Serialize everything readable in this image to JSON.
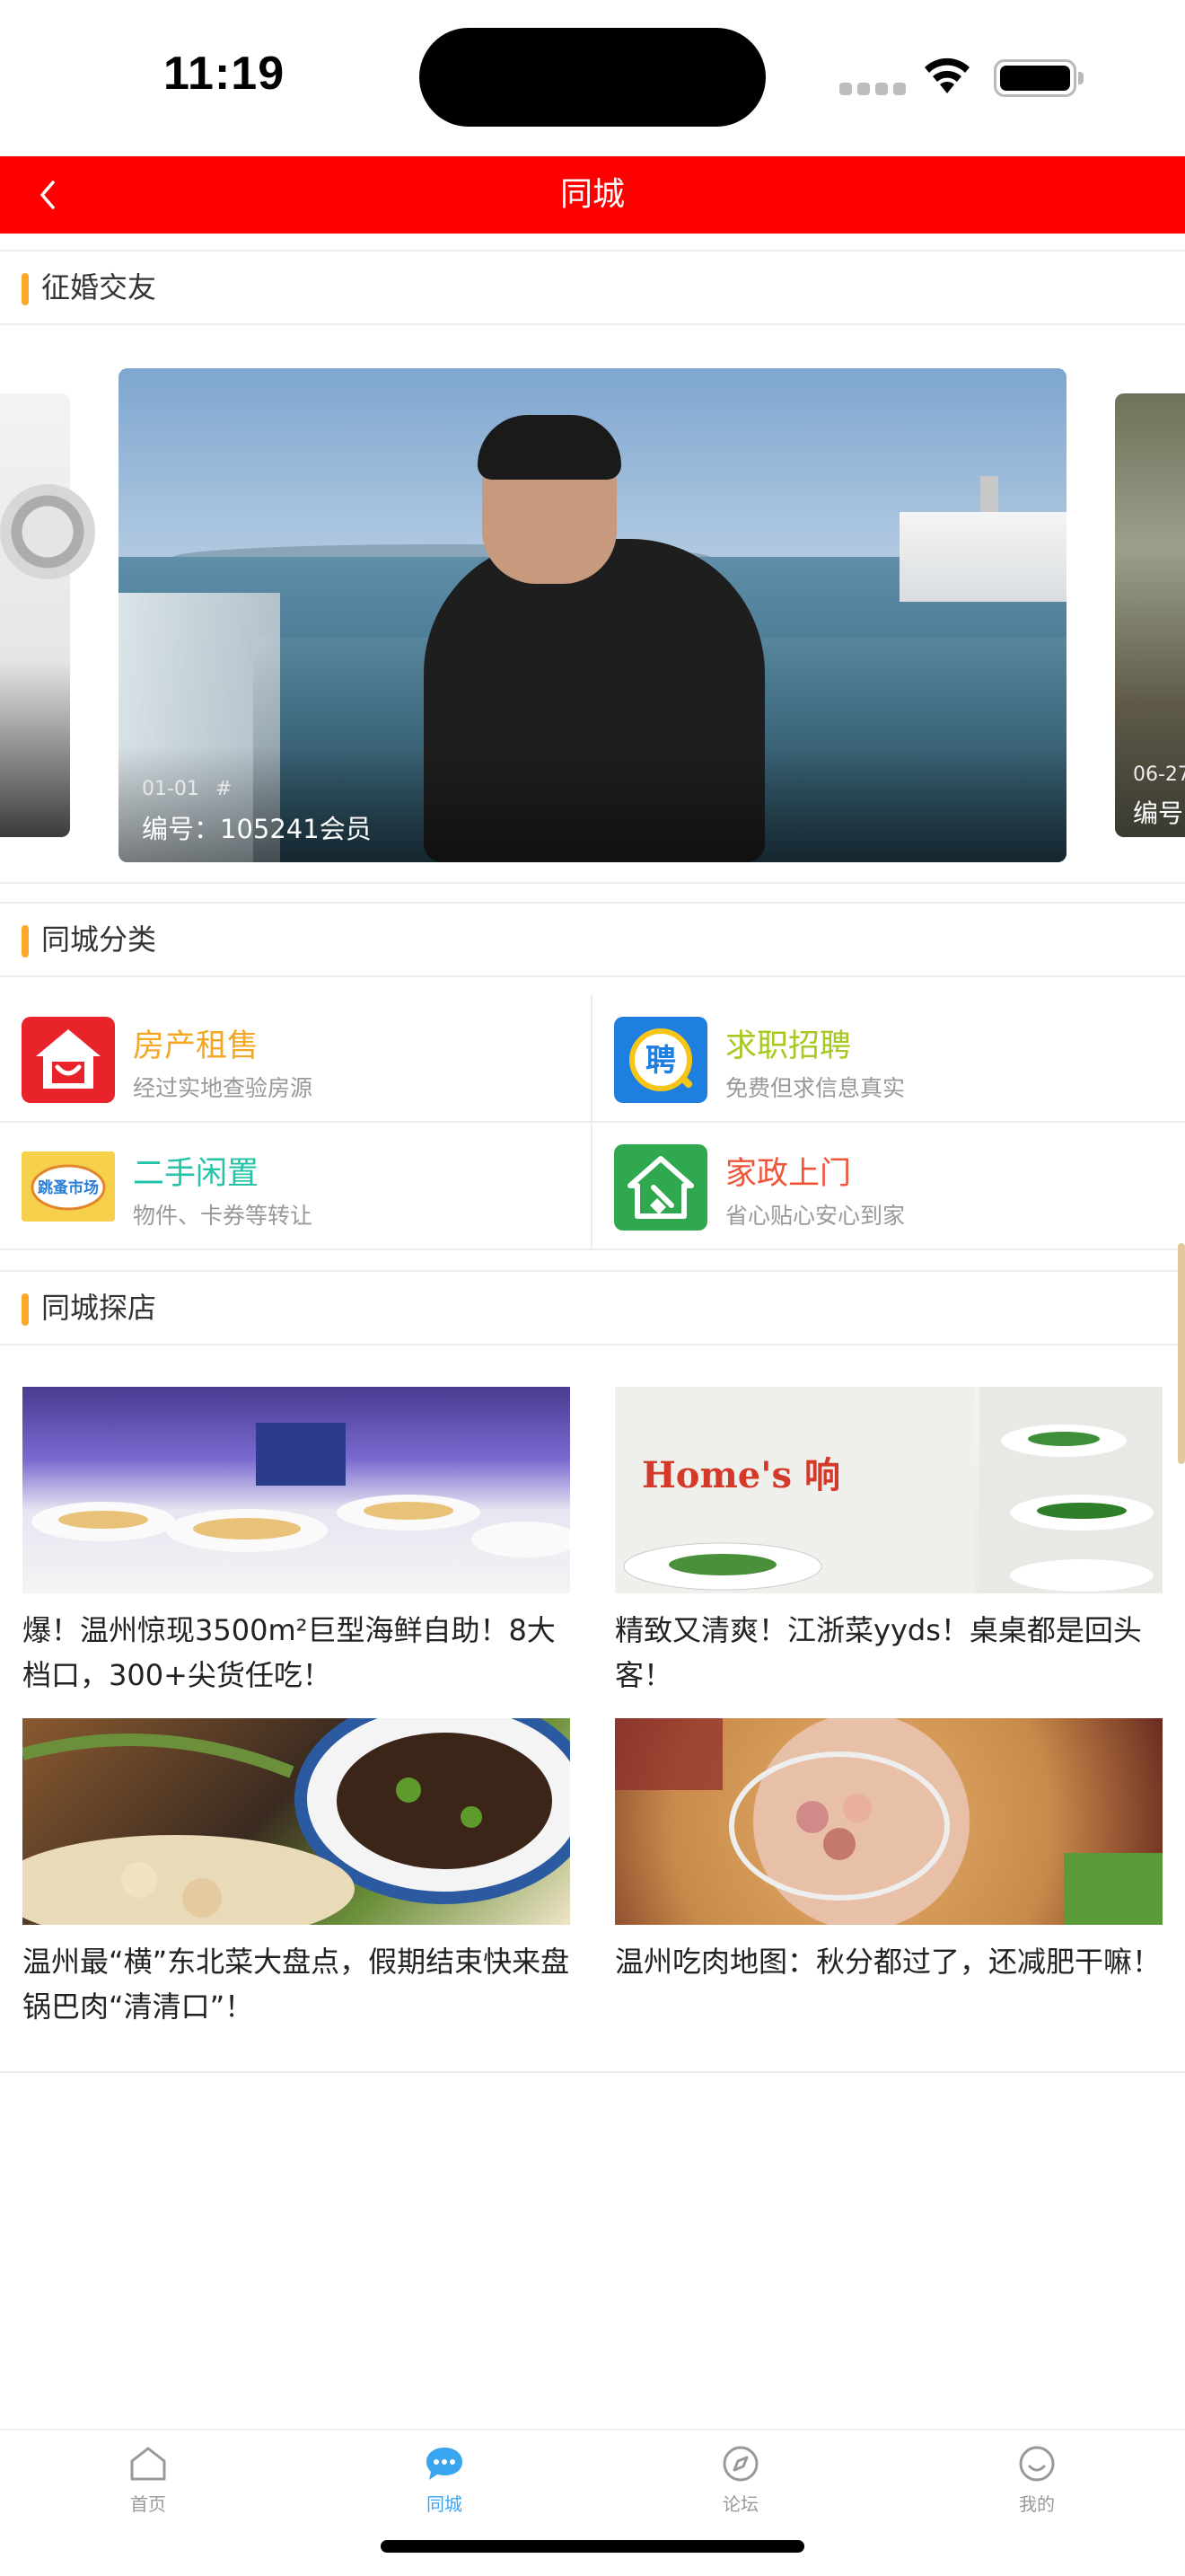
{
  "status_bar": {
    "time": "11:19"
  },
  "navbar": {
    "title": "同城"
  },
  "sections": {
    "marriage": "征婚交友",
    "categories": "同城分类",
    "shops": "同城探店"
  },
  "carousel": {
    "main": {
      "date": "01-01",
      "tag": "#",
      "id_label": "编号：105241会员"
    },
    "right": {
      "date": "06-27",
      "id_label": "编号"
    }
  },
  "categories": [
    {
      "name": "房产租售",
      "desc": "经过实地查验房源",
      "color": "#f5a623",
      "icon": "house-rental-icon"
    },
    {
      "name": "求职招聘",
      "desc": "免费但求信息真实",
      "color": "#a6c81f",
      "icon": "job-recruit-icon",
      "icon_text": "聘"
    },
    {
      "name": "二手闲置",
      "desc": "物件、卡券等转让",
      "color": "#22c3a6",
      "icon": "flea-market-icon",
      "icon_text": "跳蚤市场"
    },
    {
      "name": "家政上门",
      "desc": "省心贴心安心到家",
      "color": "#f0553a",
      "icon": "housekeeping-icon"
    }
  ],
  "articles": [
    {
      "title": "爆！温州惊现3500m²巨型海鲜自助！8大档口，300+尖货任吃！"
    },
    {
      "title": "精致又清爽！江浙菜yyds！桌桌都是回头客！",
      "thumb_text": "Home's 响"
    },
    {
      "title": "温州最“横”东北菜大盘点，假期结束快来盘锅巴肉“清清口”！"
    },
    {
      "title": "温州吃肉地图：秋分都过了，还减肥干嘛！"
    }
  ],
  "tabbar": {
    "items": [
      {
        "label": "首页",
        "icon": "home-icon",
        "active": false
      },
      {
        "label": "同城",
        "icon": "chat-bubble-icon",
        "active": true
      },
      {
        "label": "论坛",
        "icon": "compass-icon",
        "active": false
      },
      {
        "label": "我的",
        "icon": "smiley-icon",
        "active": false
      }
    ]
  },
  "colors": {
    "nav_red": "#ff0000",
    "accent_orange": "#ffa726",
    "tab_active": "#3aa5ef"
  }
}
